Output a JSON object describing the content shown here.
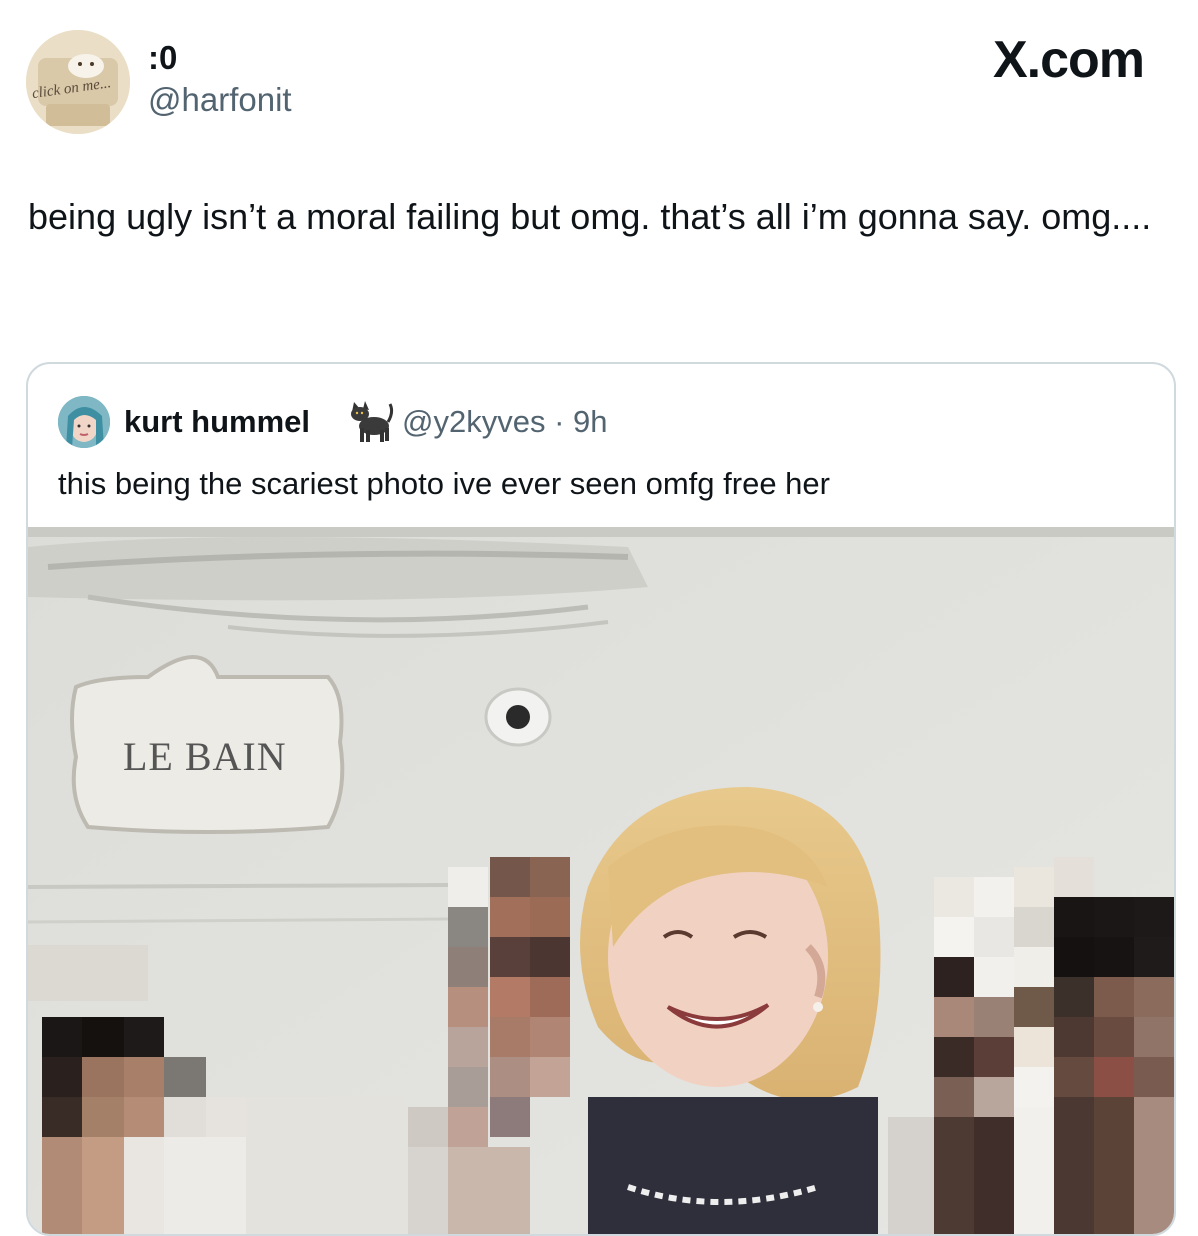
{
  "header": {
    "display_name": ":0",
    "handle": "@harfonit",
    "brand": "X.com",
    "avatar_caption": "click on me..."
  },
  "tweet": {
    "text": "being ugly isn’t a moral failing but omg. that’s all i’m gonna say. omg...."
  },
  "quoted_tweet": {
    "name": "kurt hummel",
    "emoji_icon": "cat-icon",
    "handle_time": "@y2kyves · 9h",
    "text": "this being the scariest photo ive ever seen omfg free her",
    "photo": {
      "sign_text": "LE BAIN"
    }
  }
}
